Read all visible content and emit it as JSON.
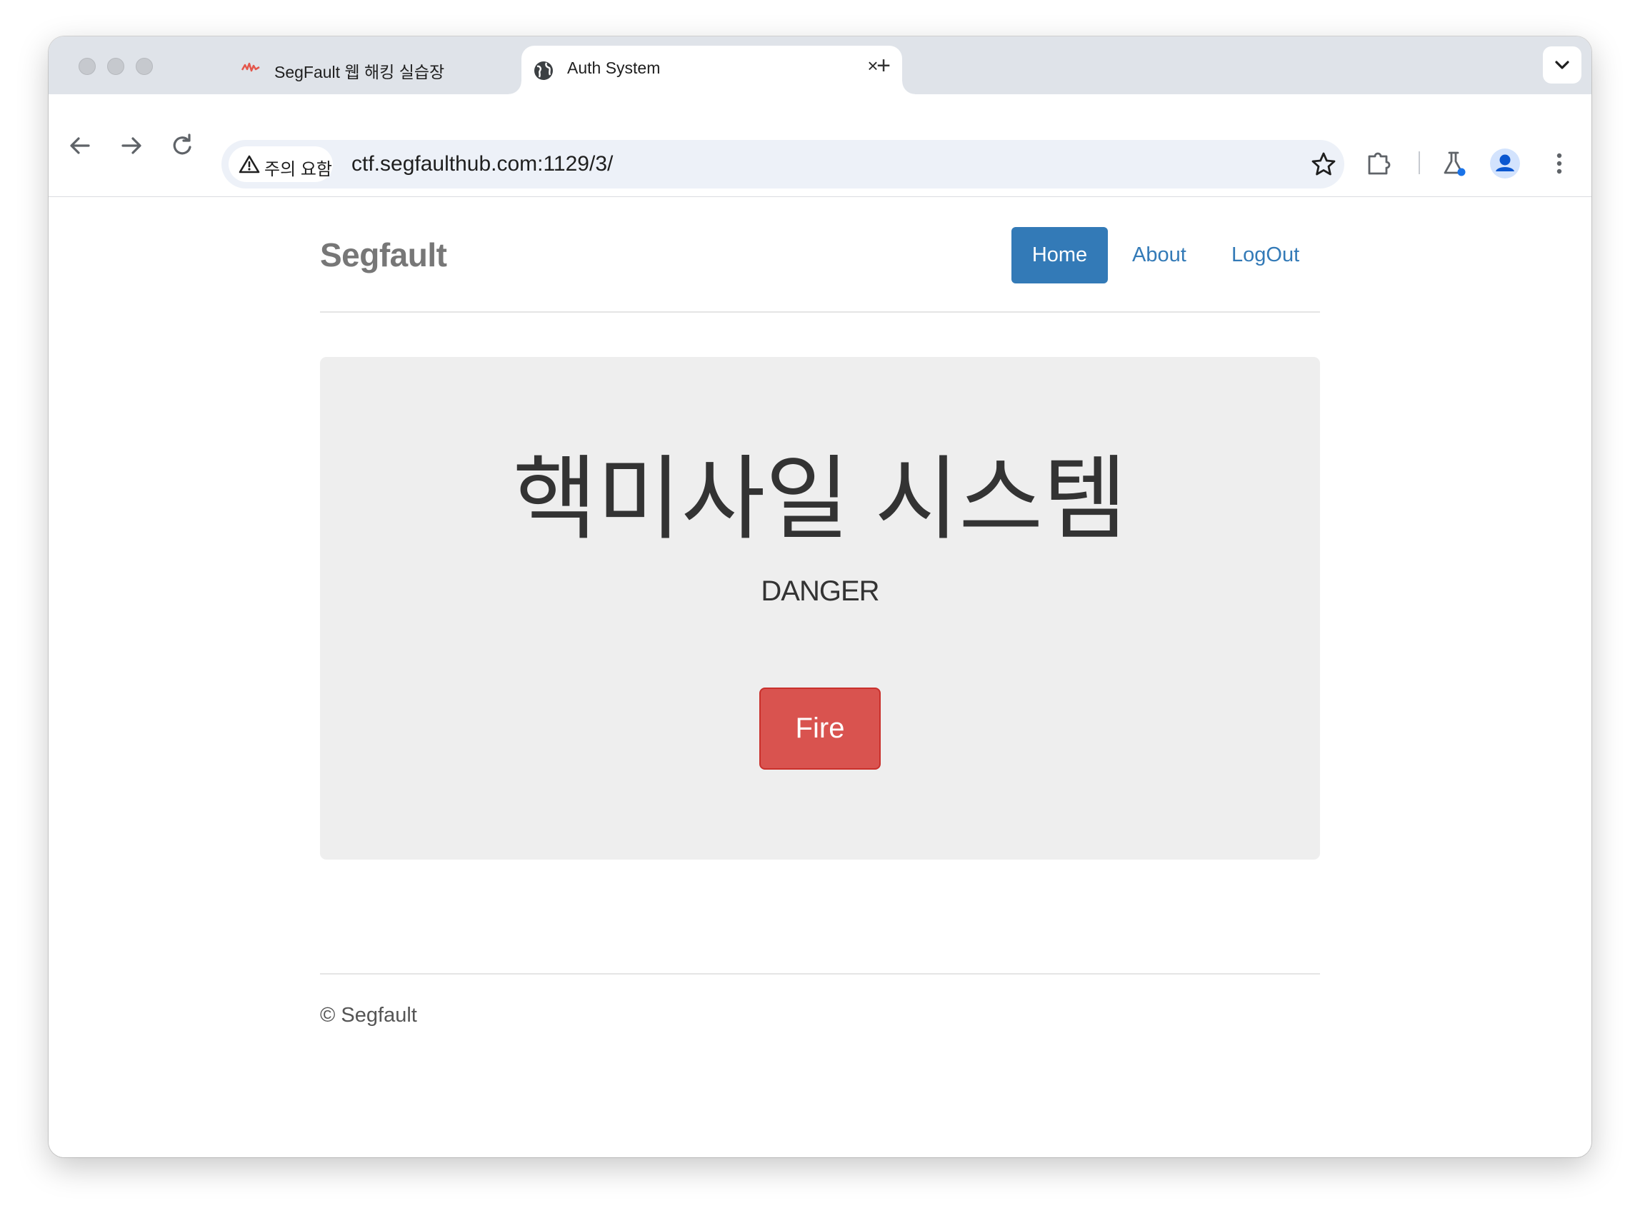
{
  "browser": {
    "tabs": [
      {
        "title": "SegFault 웹 해킹 실습장",
        "icon": "segfault-favicon",
        "active": false
      },
      {
        "title": "Auth System",
        "icon": "globe-icon",
        "active": true
      }
    ],
    "address": {
      "security_chip": "주의 요함",
      "url": "ctf.segfaulthub.com:1129/3/"
    }
  },
  "page": {
    "brand": "Segfault",
    "nav": {
      "home": "Home",
      "about": "About",
      "logout": "LogOut"
    },
    "jumbotron": {
      "title": "핵미사일 시스템",
      "subtitle": "DANGER",
      "button": "Fire"
    },
    "footer": "© Segfault"
  },
  "colors": {
    "primary": "#337ab7",
    "danger": "#d9534f",
    "jumbotron_bg": "#eeeeee",
    "brand_text": "#777777"
  }
}
